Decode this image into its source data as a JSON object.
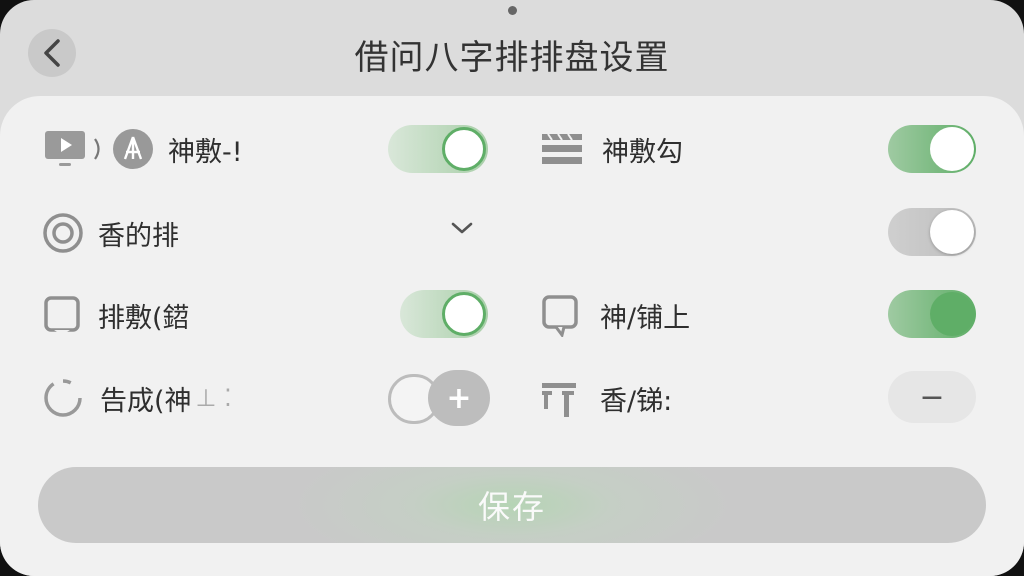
{
  "header": {
    "title": "借问八字排排盘设置",
    "back_icon": "chevron-left-icon"
  },
  "settings": {
    "row1_left_label": "神敷-!",
    "row1_right_label": "神敷勾",
    "row2_left_label": "香的排",
    "row3_left_label": "排敷(鍣",
    "row3_right_label": "神/铺上",
    "row4_left_label": "告成(神",
    "row4_left_suffix": "⊥ ⁚",
    "row4_right_label": "香/锑:",
    "row4_left_add_symbol": "+",
    "row4_right_stepper_symbol": "−"
  },
  "save": {
    "label": "保存"
  },
  "colors": {
    "accent": "#5fae67",
    "background": "#dcdcdc",
    "panel": "#f1f1f1"
  }
}
